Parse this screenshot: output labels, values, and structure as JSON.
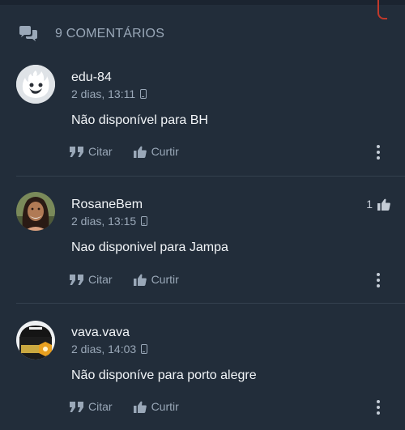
{
  "header": {
    "comment_count_label": "9 COMENTÁRIOS"
  },
  "comments": [
    {
      "author": "edu-84",
      "time": "2 dias, 13:11",
      "text": "Não disponível para BH",
      "likes": ""
    },
    {
      "author": "RosaneBem",
      "time": "2 dias, 13:15",
      "text": "Nao disponivel para Jampa",
      "likes": "1"
    },
    {
      "author": "vava.vava",
      "time": "2 dias, 14:03",
      "text": "Não disponíve para porto alegre",
      "likes": ""
    }
  ],
  "actions": {
    "quote_label": "Citar",
    "like_label": "Curtir"
  },
  "colors": {
    "background": "#222d3a",
    "muted": "#9aa8b8",
    "text": "#f2f5f8",
    "divider": "#34404e"
  }
}
